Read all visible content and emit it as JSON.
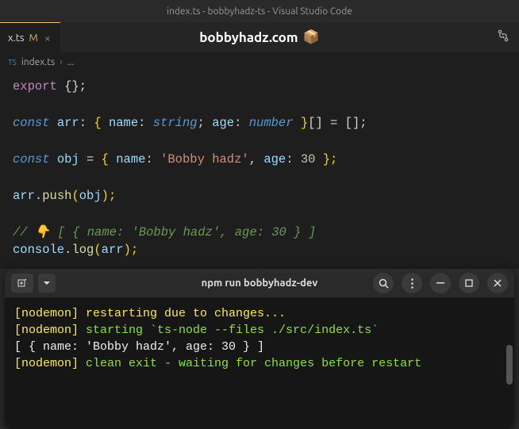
{
  "titlebar": "index.ts - bobbyhadz-ts - Visual Studio Code",
  "tab": {
    "label": "x.ts",
    "modified": "M"
  },
  "center": "bobbyhadz.com",
  "breadcrumb": {
    "file": "index.ts",
    "more": "..."
  },
  "code": {
    "l1_export": "export",
    "l1_rest": " {};",
    "l3_const": "const",
    "l3_arr": " arr",
    "l3_colon1": ": ",
    "l3_open": "{ ",
    "l3_name": "name",
    "l3_c2": ": ",
    "l3_str": "string",
    "l3_semi": "; ",
    "l3_age": "age",
    "l3_c3": ": ",
    "l3_num": "number",
    "l3_close": " }",
    "l3_arrp": "[] = [];",
    "l5_const": "const",
    "l5_obj": " obj",
    "l5_eq": " = ",
    "l5_open": "{ ",
    "l5_name": "name",
    "l5_c1": ": ",
    "l5_str": "'Bobby hadz'",
    "l5_comma": ", ",
    "l5_age": "age",
    "l5_c2": ": ",
    "l5_num": "30",
    "l5_close": " };",
    "l7_arr": "arr",
    "l7_dot": ".",
    "l7_push": "push",
    "l7_open": "(",
    "l7_obj": "obj",
    "l7_close": ");",
    "l9": "// 👇 [ { name: 'Bobby hadz', age: 30 } ]",
    "l10_console": "console",
    "l10_dot": ".",
    "l10_log": "log",
    "l10_open": "(",
    "l10_arr": "arr",
    "l10_close": ");"
  },
  "terminal": {
    "title": "npm run bobbyhadz-dev",
    "l1_tag": "[nodemon]",
    "l1_rest": " restarting due to changes...",
    "l2_tag": "[nodemon]",
    "l2_a": " starting ",
    "l2_b": "`ts-node --files ./src/index.ts`",
    "l3": "[ { name: 'Bobby hadz', age: 30 } ]",
    "l4_tag": "[nodemon]",
    "l4_rest": " clean exit - waiting for changes before restart"
  }
}
